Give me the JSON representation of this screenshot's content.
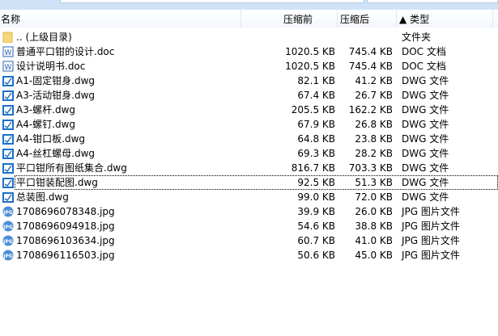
{
  "header": {
    "name": "名称",
    "before": "压缩前",
    "after": "压缩后",
    "sort_arrow": "▲",
    "type": "类型"
  },
  "rows": [
    {
      "name": ".. (上级目录)",
      "before": "",
      "after": "",
      "type": "文件夹",
      "icon": "folder"
    },
    {
      "name": "普通平口钳的设计.doc",
      "before": "1020.5 KB",
      "after": "745.4 KB",
      "type": "DOC 文档",
      "icon": "doc"
    },
    {
      "name": "设计说明书.doc",
      "before": "1020.5 KB",
      "after": "745.4 KB",
      "type": "DOC 文档",
      "icon": "doc"
    },
    {
      "name": "A1-固定钳身.dwg",
      "before": "82.1 KB",
      "after": "41.2 KB",
      "type": "DWG 文件",
      "icon": "dwg"
    },
    {
      "name": "A3-活动钳身.dwg",
      "before": "67.4 KB",
      "after": "26.7 KB",
      "type": "DWG 文件",
      "icon": "dwg"
    },
    {
      "name": "A3-螺杆.dwg",
      "before": "205.5 KB",
      "after": "162.2 KB",
      "type": "DWG 文件",
      "icon": "dwg"
    },
    {
      "name": "A4-螺钉.dwg",
      "before": "67.9 KB",
      "after": "26.8 KB",
      "type": "DWG 文件",
      "icon": "dwg"
    },
    {
      "name": "A4-钳口板.dwg",
      "before": "64.8 KB",
      "after": "23.8 KB",
      "type": "DWG 文件",
      "icon": "dwg"
    },
    {
      "name": "A4-丝杠螺母.dwg",
      "before": "69.3 KB",
      "after": "28.2 KB",
      "type": "DWG 文件",
      "icon": "dwg"
    },
    {
      "name": "平口钳所有图纸集合.dwg",
      "before": "816.7 KB",
      "after": "703.3 KB",
      "type": "DWG 文件",
      "icon": "dwg"
    },
    {
      "name": "平口钳装配图.dwg",
      "before": "92.5 KB",
      "after": "51.3 KB",
      "type": "DWG 文件",
      "icon": "dwg"
    },
    {
      "name": "总装图.dwg",
      "before": "99.0 KB",
      "after": "72.0 KB",
      "type": "DWG 文件",
      "icon": "dwg"
    },
    {
      "name": "1708696078348.jpg",
      "before": "39.9 KB",
      "after": "26.0 KB",
      "type": "JPG 图片文件",
      "icon": "jpg"
    },
    {
      "name": "1708696094918.jpg",
      "before": "54.6 KB",
      "after": "38.8 KB",
      "type": "JPG 图片文件",
      "icon": "jpg"
    },
    {
      "name": "1708696103634.jpg",
      "before": "60.7 KB",
      "after": "41.0 KB",
      "type": "JPG 图片文件",
      "icon": "jpg"
    },
    {
      "name": "1708696116503.jpg",
      "before": "50.6 KB",
      "after": "45.0 KB",
      "type": "JPG 图片文件",
      "icon": "jpg"
    }
  ],
  "focused_index": 10,
  "colors": {
    "accent": "#1e6fc8",
    "folder": "#f5d77a"
  }
}
